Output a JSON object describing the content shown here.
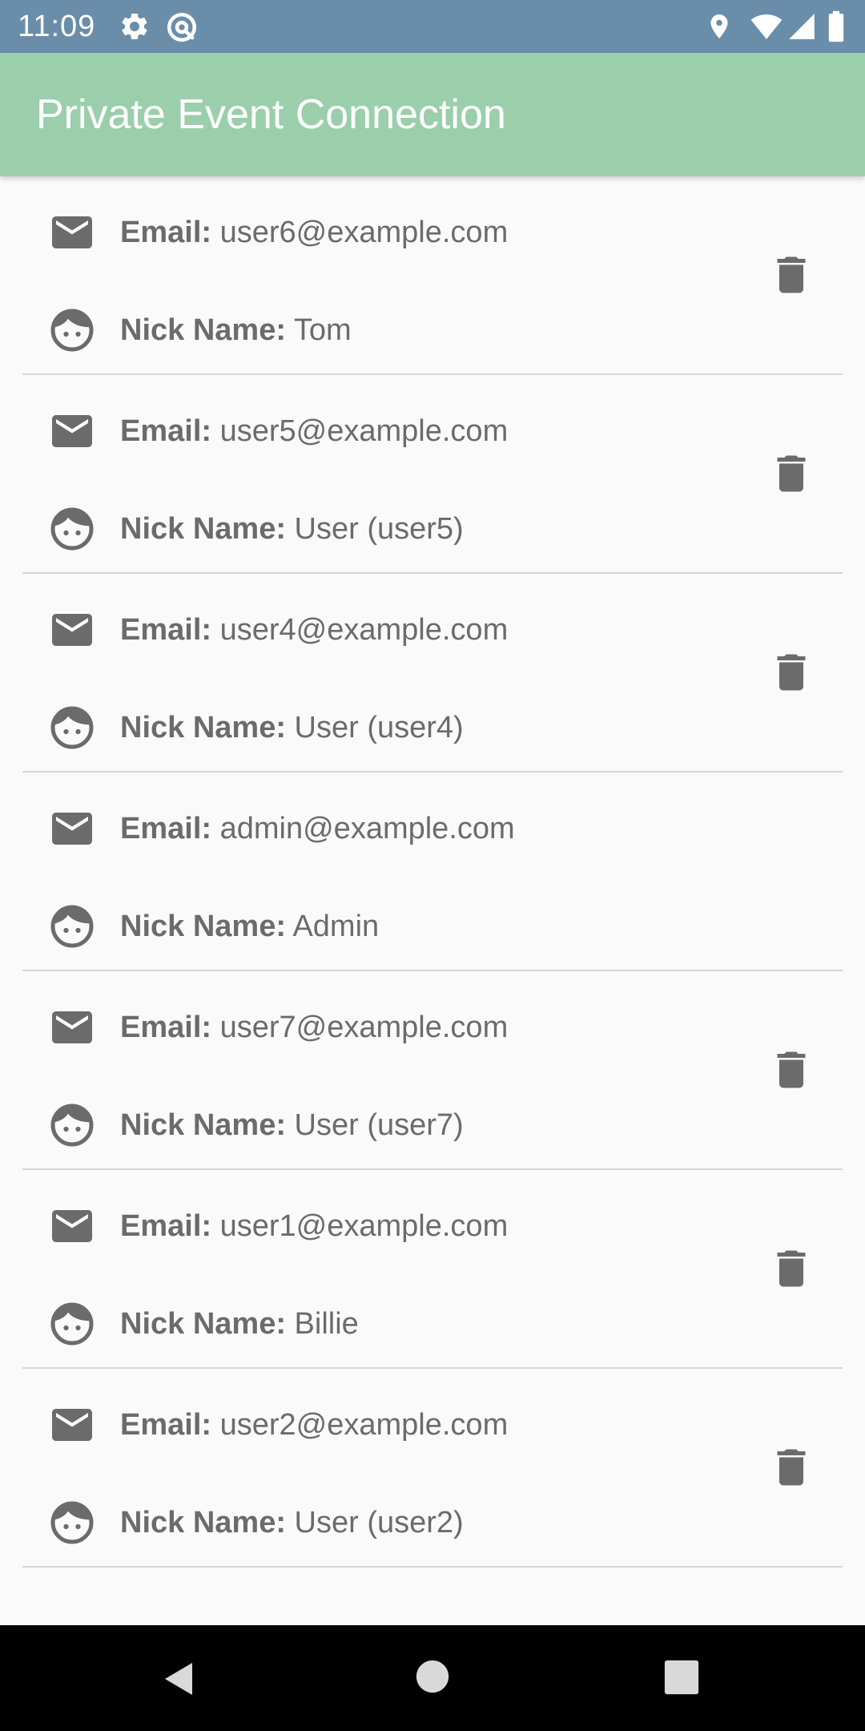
{
  "status_bar": {
    "time": "11:09",
    "left_icons": [
      "gear-icon",
      "sync-icon"
    ],
    "right_icons": [
      "location-icon",
      "wifi-icon",
      "signal-icon",
      "battery-icon"
    ],
    "background": "#6a8ea9"
  },
  "app_bar": {
    "title": "Private Event Connection",
    "background": "#9bceaa"
  },
  "labels": {
    "email": "Email:",
    "nick": "Nick Name:"
  },
  "users": [
    {
      "email": "user6@example.com",
      "nick": "Tom",
      "deletable": true
    },
    {
      "email": "user5@example.com",
      "nick": "User (user5)",
      "deletable": true
    },
    {
      "email": "user4@example.com",
      "nick": "User (user4)",
      "deletable": true
    },
    {
      "email": "admin@example.com",
      "nick": "Admin",
      "deletable": false
    },
    {
      "email": "user7@example.com",
      "nick": "User (user7)",
      "deletable": true
    },
    {
      "email": "user1@example.com",
      "nick": "Billie",
      "deletable": true
    },
    {
      "email": "user2@example.com",
      "nick": "User (user2)",
      "deletable": true
    }
  ],
  "icons": {
    "email": "email-icon",
    "nick": "face-icon",
    "delete": "trash-icon",
    "color": "#6b6b6b"
  },
  "nav_bar": {
    "buttons": [
      "back-icon",
      "home-icon",
      "recents-icon"
    ]
  }
}
